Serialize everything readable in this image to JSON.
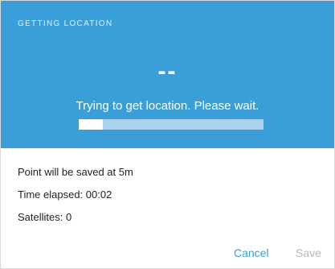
{
  "dialog": {
    "title": "GETTING LOCATION",
    "accuracy_value": "--",
    "status": "Trying to get location. Please wait.",
    "progress": 0.13,
    "colors": {
      "header_bg": "#3a9fd8",
      "progress_track": "#a9d2ed",
      "progress_fill": "#ffffff",
      "accent": "#3a9fd8",
      "disabled": "#b8b8b8"
    }
  },
  "info": {
    "save_point": "Point will be saved at 5m",
    "time_elapsed": "Time elapsed: 00:02",
    "satellites": "Satellites: 0"
  },
  "actions": {
    "cancel_label": "Cancel",
    "save_label": "Save"
  }
}
